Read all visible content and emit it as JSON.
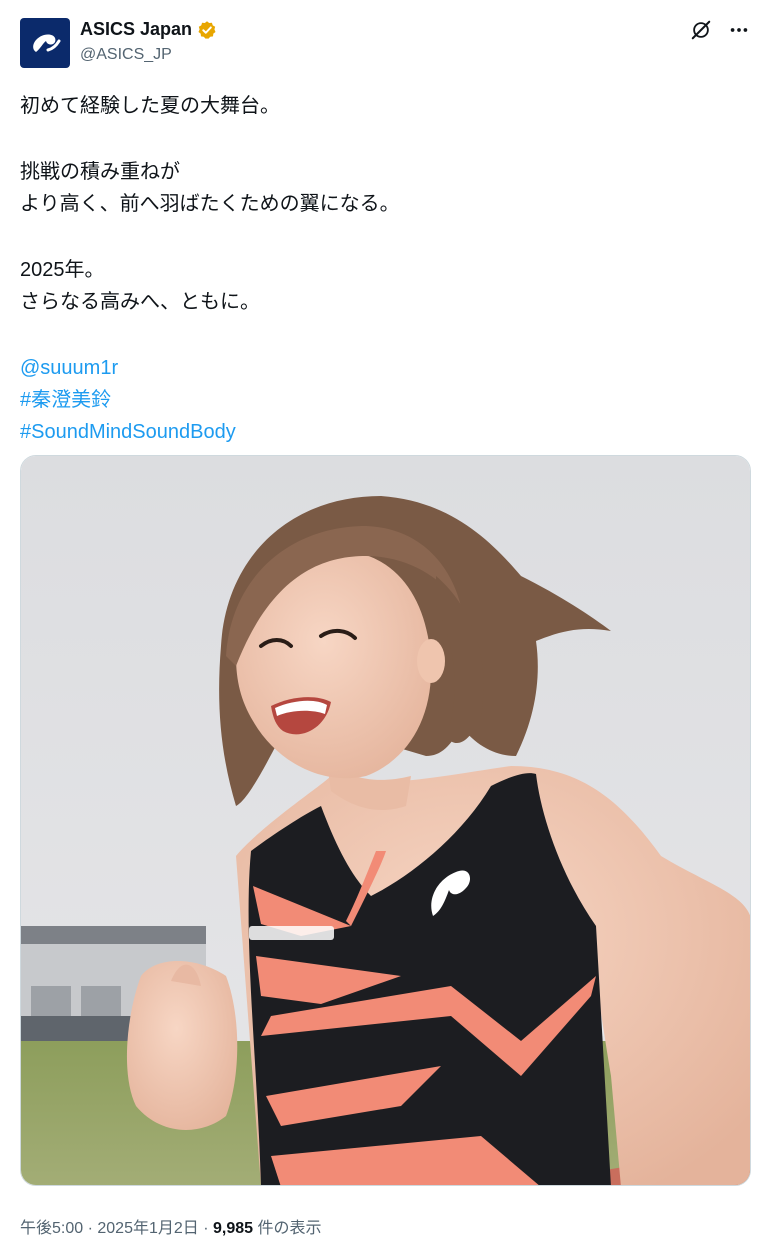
{
  "account": {
    "display_name": "ASICS Japan",
    "handle": "@ASICS_JP",
    "avatar_icon": "asics-logo-icon",
    "verified_icon": "verified-badge-icon",
    "brand_color": "#0b2a6b",
    "badge_color": "#e8a600"
  },
  "toolbar": {
    "grok_icon": "grok-icon",
    "more_icon": "more-icon"
  },
  "post": {
    "lines": [
      "初めて経験した夏の大舞台。",
      "挑戦の積み重ねが",
      "より高く、前へ羽ばたくための翼になる。",
      "2025年。",
      "さらなる高みへ、ともに。"
    ],
    "mention": "@suuum1r",
    "hashtag_1": "#秦澄美鈴",
    "hashtag_2": "#SoundMindSoundBody",
    "link_color": "#1d9bf0"
  },
  "meta": {
    "time": "午後5:00",
    "sep1": " · ",
    "date": "2025年1月2日",
    "sep2": " · ",
    "views": "9,985",
    "views_label": " 件の表示"
  }
}
